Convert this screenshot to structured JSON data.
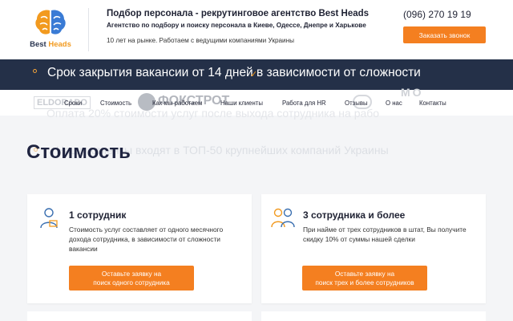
{
  "logo": {
    "part1": "Best",
    "part2": "Heads"
  },
  "header": {
    "title": "Подбор персонала - рекрутинговое агентство Best Heads",
    "subtitle": "Агентство по подбору и поиску персонала в Киеве, Одессе, Днепре и Харькове",
    "years": "10 лет на рынке. Работаем с ведущими компаниями Украины",
    "phone": "(096) 270 19 19",
    "call_button": "Заказать звонок"
  },
  "banner": {
    "text": "Срок закрытия вакансии от 14 дней в зависимости от сложности"
  },
  "partners": {
    "eldorado": "ELDORADO",
    "foxtrot": "ФОКСТРОТ",
    "mo": "MO"
  },
  "nav": {
    "items": [
      "Сроки",
      "Стоимость",
      "Как мы работаем",
      "Наши клиенты",
      "Работа для HR",
      "Отзывы",
      "О нас",
      "Контакты"
    ]
  },
  "faded": {
    "line1": "Оплата 20% стоимости услуг после выхода сотрудника на рабо",
    "line2": "Наши клиенты входят в ТОП-50 крупнейших компаний Украины"
  },
  "section": {
    "title": "Стоимость"
  },
  "cards": [
    {
      "title": "1 сотрудник",
      "description": "Стоимость услуг составляет от одного месячного дохода сотрудника, в зависимости от сложности вакансии",
      "button": "Оставьте заявку на\nпоиск одного сотрудника"
    },
    {
      "title": "3 сотрудника и более",
      "description": "При найме от трех сотрудников в штат, Вы получите скидку 10% от суммы нашей сделки",
      "button": "Оставьте заявку на\nпоиск трех и более сотрудников"
    }
  ],
  "colors": {
    "accent": "#f47f20",
    "banner": "#243048",
    "logo_orange": "#f29a1f",
    "logo_blue": "#3a7bd5"
  }
}
